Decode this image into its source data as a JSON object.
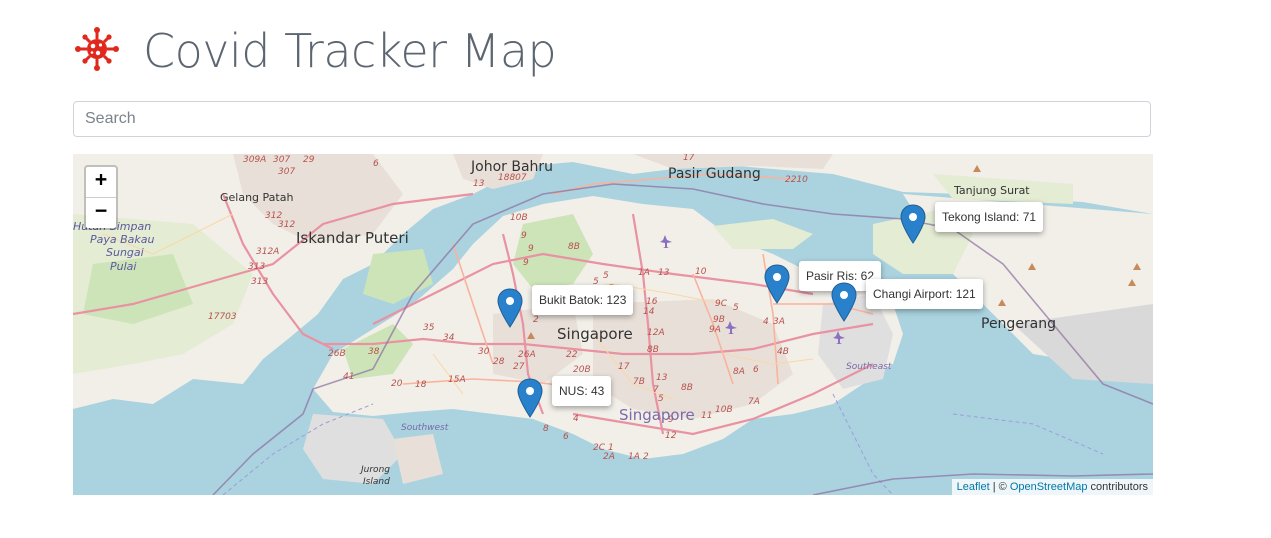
{
  "header": {
    "title": "Covid Tracker Map",
    "logo_icon": "virus-icon",
    "logo_color": "#e0281c"
  },
  "search": {
    "placeholder": "Search",
    "value": ""
  },
  "map": {
    "zoom_in_label": "+",
    "zoom_out_label": "−",
    "attribution": {
      "leaflet": "Leaflet",
      "sep": " | © ",
      "osm": "OpenStreetMap",
      "suffix": " contributors"
    },
    "places": {
      "johor_bahru": "Johor Bahru",
      "pasir_gudang": "Pasir Gudang",
      "tanjung_surat": "Tanjung Surat",
      "gelang_patah": "Gelang Patah",
      "iskandar_puteri": "Iskandar Puteri",
      "hutan_simpan": "Hutan Simpan",
      "paya_bakau": "Paya Bakau",
      "sungai": "Sungai",
      "pulai": "Pulai",
      "singapore_mid": "Singapore",
      "singapore_south": "Singapore",
      "pengerang": "Pengerang",
      "southwest": "Southwest",
      "southeast": "Southeast",
      "jurong": "Jurong",
      "island": "Island"
    },
    "markers": [
      {
        "name": "Tekong Island",
        "count": "71",
        "label": "Tekong Island: 71"
      },
      {
        "name": "Pasir Ris",
        "count": "62",
        "label": "Pasir Ris: 62"
      },
      {
        "name": "Changi Airport",
        "count": "121",
        "label": "Changi Airport: 121"
      },
      {
        "name": "Bukit Batok",
        "count": "123",
        "label": "Bukit Batok: 123"
      },
      {
        "name": "NUS",
        "count": "43",
        "label": "NUS: 43"
      }
    ],
    "marker_color": "#2a81cb",
    "water_color": "#aad3df"
  }
}
